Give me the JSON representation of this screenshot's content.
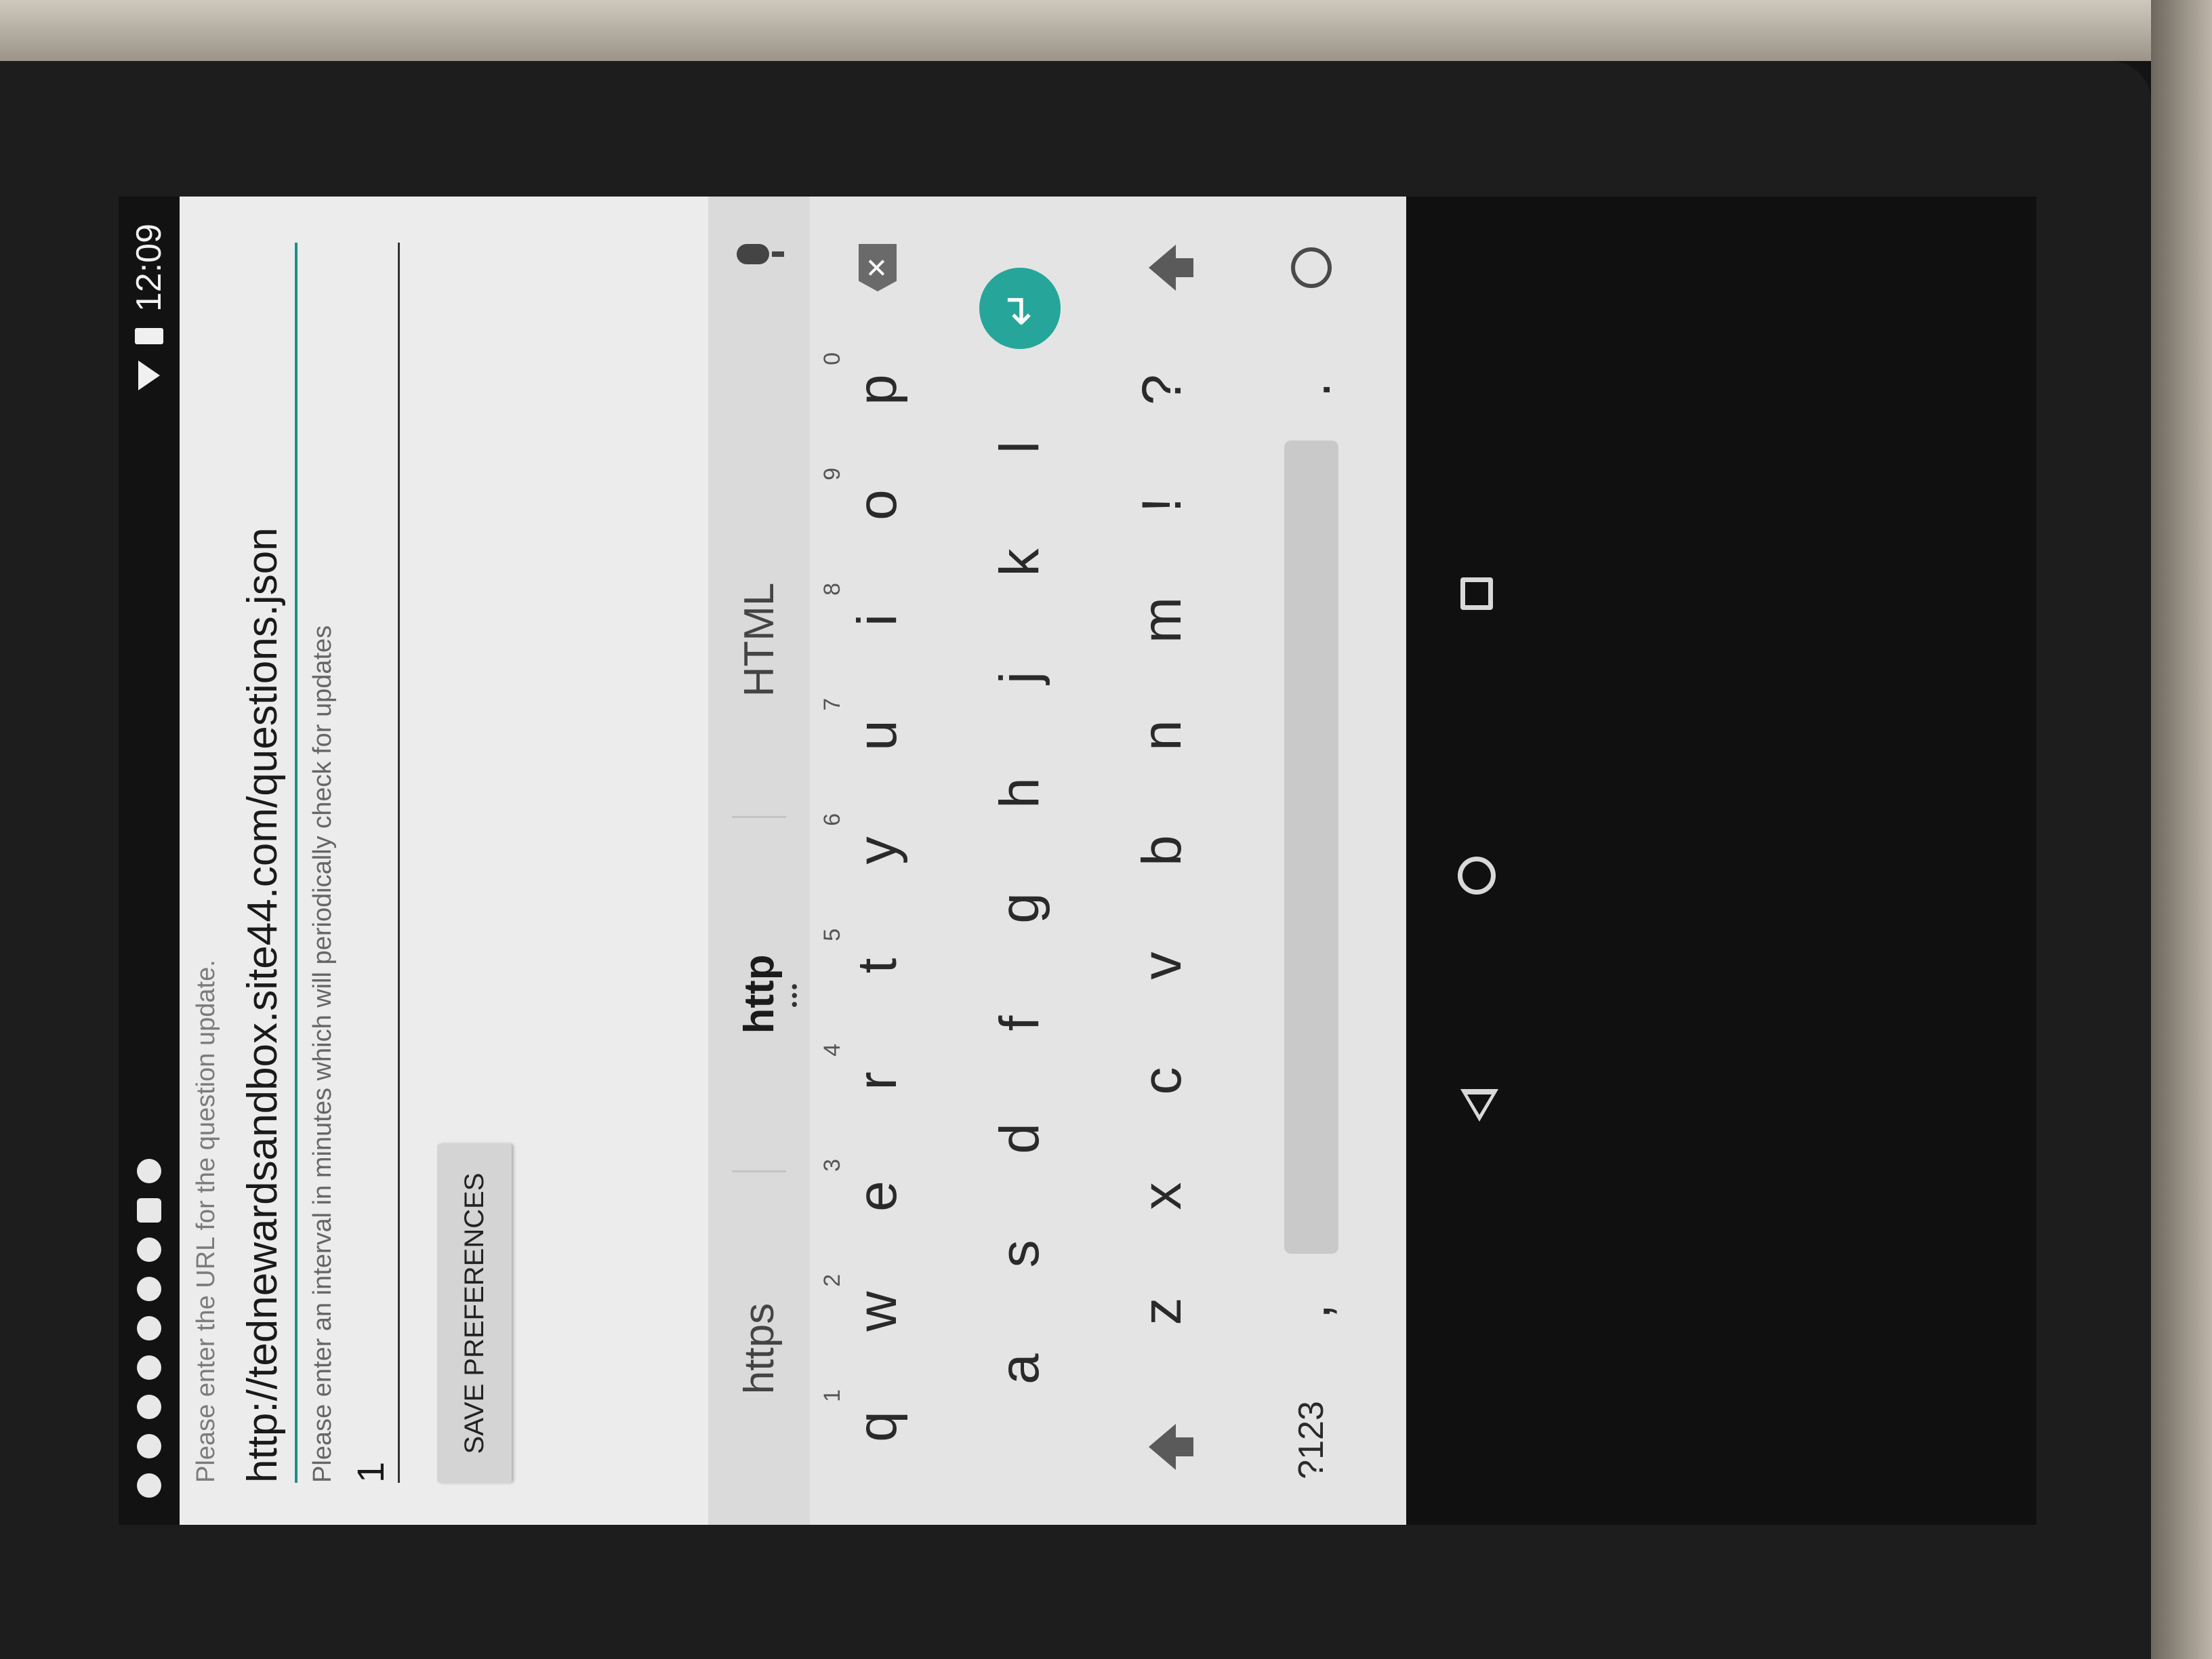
{
  "status_bar": {
    "time": "12:09",
    "icons": [
      "notification-icon",
      "notification-icon",
      "notification-icon",
      "notification-icon",
      "notification-icon",
      "notification-icon",
      "notification-icon",
      "notification-icon",
      "notification-icon"
    ]
  },
  "form": {
    "url_label": "Please enter the URL for the question update.",
    "url_value": "http://tednewardsandbox.site44.com/questions.json",
    "interval_label": "Please enter an interval in minutes which will periodically check for updates",
    "interval_value": "1",
    "save_label": "SAVE PREFERENCES"
  },
  "keyboard": {
    "suggestions": [
      "https",
      "http",
      "HTML"
    ],
    "row1": [
      {
        "key": "q",
        "num": "1"
      },
      {
        "key": "w",
        "num": "2"
      },
      {
        "key": "e",
        "num": "3"
      },
      {
        "key": "r",
        "num": "4"
      },
      {
        "key": "t",
        "num": "5"
      },
      {
        "key": "y",
        "num": "6"
      },
      {
        "key": "u",
        "num": "7"
      },
      {
        "key": "i",
        "num": "8"
      },
      {
        "key": "o",
        "num": "9"
      },
      {
        "key": "p",
        "num": "0"
      }
    ],
    "row2": [
      "a",
      "s",
      "d",
      "f",
      "g",
      "h",
      "j",
      "k",
      "l"
    ],
    "row3": [
      "z",
      "x",
      "c",
      "v",
      "b",
      "n",
      "m",
      "!",
      "?"
    ],
    "symbols_label": "?123",
    "comma_label": ",",
    "period_label": ".",
    "enter_glyph": "↵",
    "backspace_glyph": "✕"
  }
}
